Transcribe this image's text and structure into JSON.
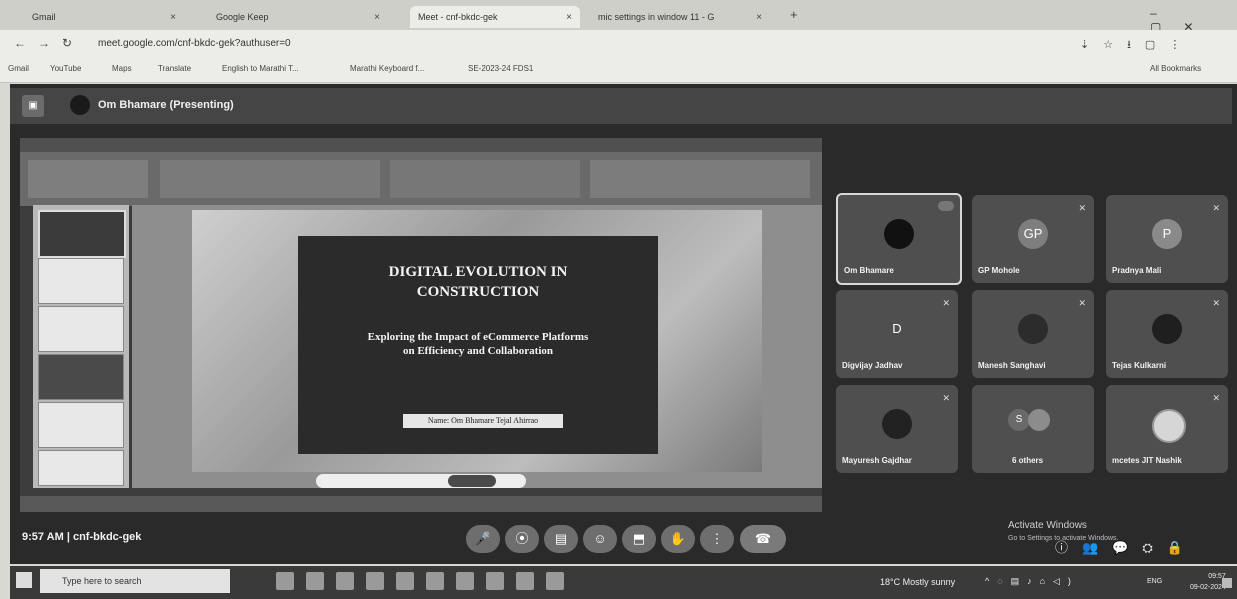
{
  "browser": {
    "tabs": [
      {
        "label": "Gmail"
      },
      {
        "label": "Google Keep"
      },
      {
        "label": "Meet - cnf-bkdc-gek"
      },
      {
        "label": "mic settings in window 11 - G"
      }
    ],
    "url": "meet.google.com/cnf-bkdc-gek?authuser=0",
    "bookmarks": [
      "Gmail",
      "YouTube",
      "Maps",
      "Translate",
      "English to Marathi T...",
      "Marathi Keyboard f...",
      "SE-2023-24 FDS1"
    ],
    "all_bookmarks": "All Bookmarks"
  },
  "meet": {
    "presenter_label": "Om Bhamare (Presenting)",
    "meeting_code": "9:57 AM  |  cnf-bkdc-gek",
    "tiles": [
      {
        "name": "Om Bhamare",
        "avatar": ""
      },
      {
        "name": "GP Mohole",
        "avatar": "GP"
      },
      {
        "name": "Pradnya Mali",
        "avatar": "P"
      },
      {
        "name": "Digvijay Jadhav",
        "avatar": "D"
      },
      {
        "name": "Manesh Sanghavi",
        "avatar": ""
      },
      {
        "name": "Tejas Kulkarni",
        "avatar": ""
      },
      {
        "name": "Mayuresh Gajdhar",
        "avatar": ""
      },
      {
        "name": "6 others",
        "avatar": "S"
      },
      {
        "name": "mcetes JIT Nashik",
        "avatar": ""
      }
    ]
  },
  "slide": {
    "title_line1": "DIGITAL EVOLUTION IN",
    "title_line2": "CONSTRUCTION",
    "subtitle_line1": "Exploring the Impact of eCommerce Platforms",
    "subtitle_line2": "on Efficiency and Collaboration",
    "footer": "Name: Om Bhamare  Tejal Ahirrao"
  },
  "windows": {
    "activate_title": "Activate Windows",
    "activate_sub": "Go to Settings to activate Windows.",
    "search_placeholder": "Type here to search",
    "weather": "18°C  Mostly sunny",
    "lang": "ENG",
    "time": "09:57",
    "date": "09-02-2024"
  },
  "colors": {
    "meet_bg": "#2a2a2a",
    "end_call": "#7a7a7a"
  }
}
